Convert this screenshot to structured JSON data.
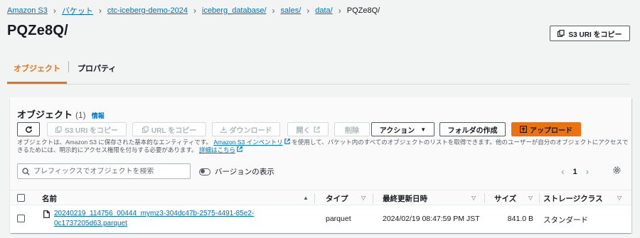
{
  "breadcrumb": {
    "items": [
      "Amazon S3",
      "バケット",
      "ctc-iceberg-demo-2024",
      "iceberg_database/",
      "sales/",
      "data/"
    ],
    "current": "PQZe8Q/"
  },
  "page": {
    "title": "PQZe8Q/",
    "copy_uri_label": "S3 URI をコピー"
  },
  "tabs": [
    {
      "label": "オブジェクト",
      "active": true
    },
    {
      "label": "プロパティ",
      "active": false
    }
  ],
  "objects_panel": {
    "title": "オブジェクト",
    "count": "(1)",
    "info_label": "情報",
    "toolbar": {
      "copy_s3_uri": "S3 URI をコピー",
      "copy_url": "URL をコピー",
      "download": "ダウンロード",
      "open": "開く",
      "delete": "削除",
      "actions": "アクション",
      "create_folder": "フォルダの作成",
      "upload": "アップロード"
    },
    "description": {
      "part1": "オブジェクトは、Amazon S3 に保存された基本的なエンティティです。",
      "inventory_link": "Amazon S3 インベントリ",
      "part2": "を使用して、バケット内のすべてのオブジェクトのリストを取得できます。他のユーザーが自分のオブジェクトにアクセスできるためには、明示的にアクセス権限を付与する必要があります。",
      "details_link": "詳細はこちら"
    },
    "search_placeholder": "プレフィックスでオブジェクトを検索",
    "show_versions_label": "バージョンの表示",
    "page_number": "1",
    "columns": [
      "名前",
      "タイプ",
      "最終更新日時",
      "サイズ",
      "ストレージクラス"
    ],
    "rows": [
      {
        "name_line1": "20240219_114756_00444_mymz3-304dc47b-2575-4491-85e2-",
        "name_line2": "0c1737205d63.parquet",
        "type": "parquet",
        "last_modified": "2024/02/19 08:47:59 PM JST",
        "size": "841.0 B",
        "storage_class": "スタンダード"
      }
    ]
  },
  "colors": {
    "accent": "#ec7211",
    "link": "#0073bb",
    "background": "#f2f3f3"
  }
}
